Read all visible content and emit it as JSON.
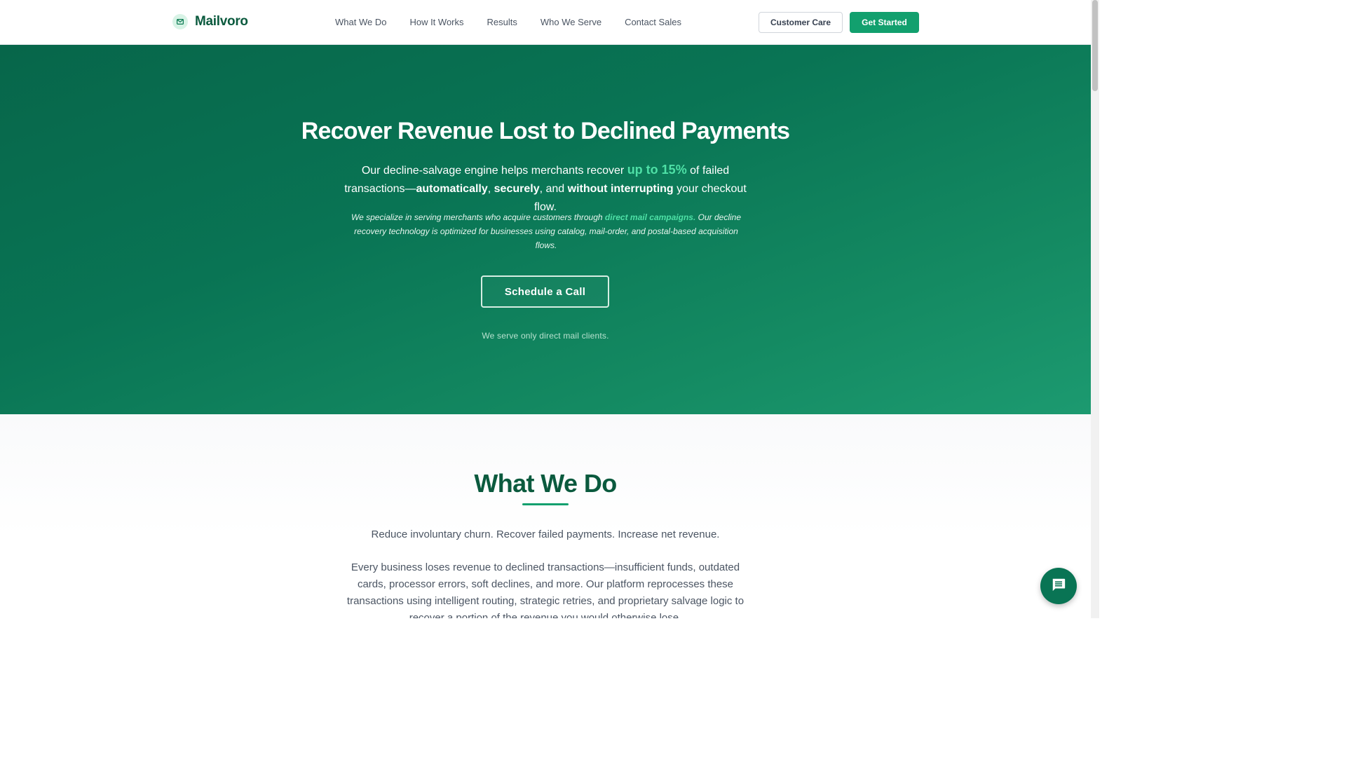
{
  "nav": {
    "brand": "Mailvoro",
    "links": [
      "What We Do",
      "How It Works",
      "Results",
      "Who We Serve",
      "Contact Sales"
    ],
    "customer_care": "Customer Care",
    "get_started": "Get Started"
  },
  "hero": {
    "title": "Recover Revenue Lost to Declined Payments",
    "sub_part1": "Our decline-salvage engine helps merchants recover ",
    "sub_highlight": "up to 15%",
    "sub_part2": " of failed transactions—",
    "sub_bold1": "automatically",
    "sub_sep1": ", ",
    "sub_bold2": "securely",
    "sub_sep2": ", and ",
    "sub_bold3": "without interrupting",
    "sub_part3": " your checkout flow.",
    "italic_part1": "We specialize in serving merchants who acquire customers through ",
    "italic_highlight": "direct mail campaigns.",
    "italic_part2": " Our decline recovery technology is optimized for businesses using catalog, mail-order, and postal-based acquisition flows.",
    "cta": "Schedule a Call",
    "note": "We serve only direct mail clients."
  },
  "what_we_do": {
    "title": "What We Do",
    "tagline": "Reduce involuntary churn. Recover failed payments. Increase net revenue.",
    "body": "Every business loses revenue to declined transactions—insufficient funds, outdated cards, processor errors, soft declines, and more. Our platform reprocesses these transactions using intelligent routing, strategic retries, and proprietary salvage logic to recover a portion of the revenue you would otherwise lose."
  },
  "colors": {
    "brand_green": "#0b5a3e",
    "accent_green": "#12a06e",
    "highlight_green": "#4ee0a6",
    "hero_bg": "#097454"
  },
  "icons": {
    "logo": "mail-icon",
    "chat": "chat-bubble-icon"
  }
}
